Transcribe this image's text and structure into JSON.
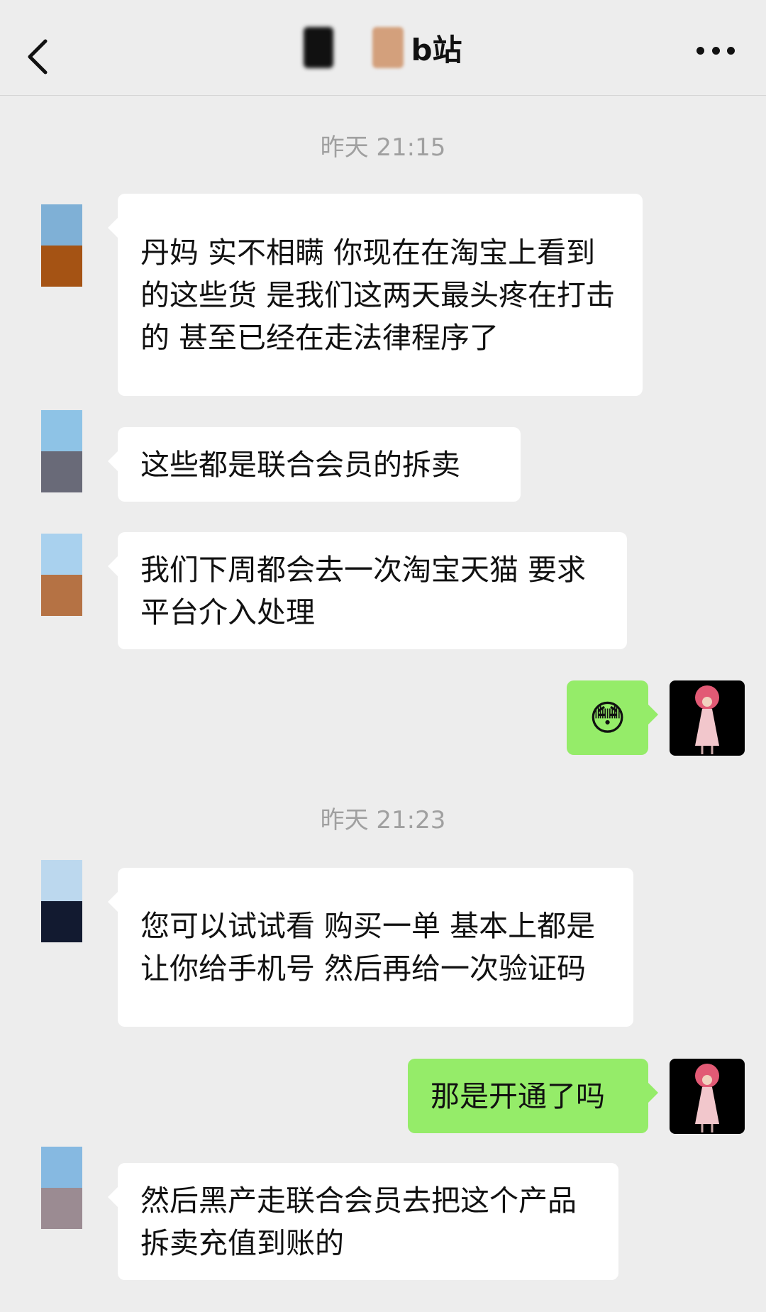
{
  "header": {
    "title": "b站"
  },
  "messages": [
    {
      "time": "昨天 21:15"
    },
    {
      "text": "丹妈 实不相瞒  你现在在淘宝上看到的这些货 是我们这两天最头疼在打击的 甚至已经在走法律程序了"
    },
    {
      "text": "这些都是联合会员的拆卖"
    },
    {
      "text": "我们下周都会去一次淘宝天猫 要求平台介入处理"
    },
    {
      "emoji": "😳"
    },
    {
      "time": "昨天 21:23"
    },
    {
      "text": "您可以试试看 购买一单 基本上都是让你给手机号 然后再给一次验证码"
    },
    {
      "text": "那是开通了吗"
    },
    {
      "text": "然后黑产走联合会员去把这个产品拆卖充值到账的"
    }
  ]
}
